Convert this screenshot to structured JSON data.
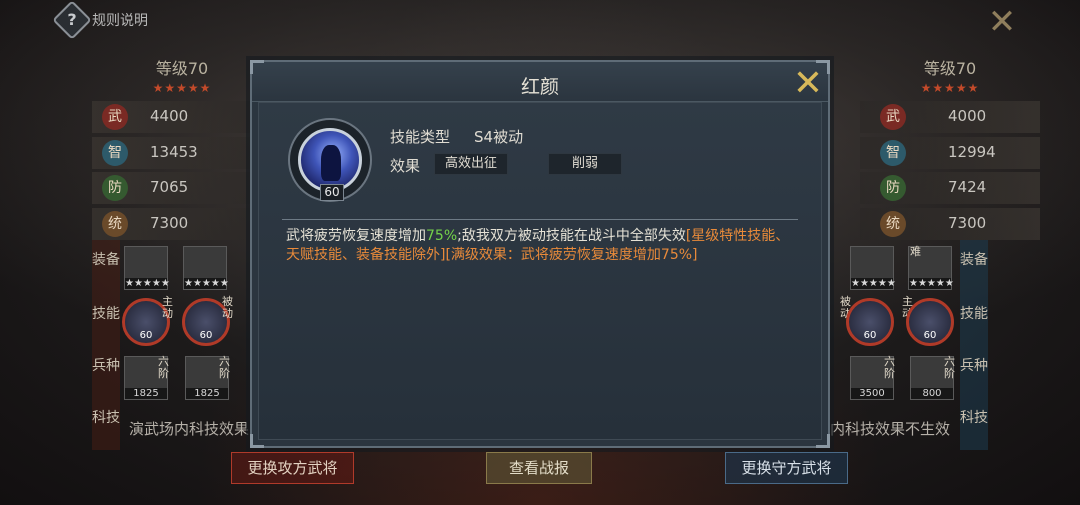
{
  "topbar": {
    "rules_label": "规则说明",
    "help_glyph": "?"
  },
  "left": {
    "level": "等级70",
    "stars": "★★★★★",
    "stats": [
      {
        "icon": "武",
        "value": "4400"
      },
      {
        "icon": "智",
        "value": "13453"
      },
      {
        "icon": "防",
        "value": "7065"
      },
      {
        "icon": "统",
        "value": "7300"
      }
    ],
    "labels": [
      "装备",
      "技能",
      "兵种",
      "科技"
    ],
    "equip_stars": "★★★★★",
    "skill_tag": "主动",
    "skill_tag2": "被动",
    "skill_levels": [
      "60",
      "60"
    ],
    "troop_counts": [
      "1825",
      "1825"
    ],
    "troop_tag": "六阶",
    "tech_text": "演武场内科技效果"
  },
  "right": {
    "level": "等级70",
    "stars": "★★★★★",
    "stats": [
      {
        "icon": "武",
        "value": "4000"
      },
      {
        "icon": "智",
        "value": "12994"
      },
      {
        "icon": "防",
        "value": "7424"
      },
      {
        "icon": "统",
        "value": "7300"
      }
    ],
    "labels": [
      "装备",
      "技能",
      "兵种",
      "科技"
    ],
    "equip_tag": "难",
    "equip_stars": "★★★★★",
    "skill_tag": "被动",
    "skill_tag2": "主动",
    "skill_levels": [
      "60",
      "60"
    ],
    "troop_counts": [
      "3500",
      "800"
    ],
    "troop_tag": "六阶",
    "tech_text": "内科技效果不生效"
  },
  "buttons": {
    "attack": "更换攻方武将",
    "report": "查看战报",
    "defend": "更换守方武将"
  },
  "modal": {
    "title": "红颜",
    "skill_level": "60",
    "type_label": "技能类型",
    "type_value": "S4被动",
    "effect_label": "效果",
    "effect_tags": [
      "高效出征",
      "削弱"
    ],
    "desc_part1": "武将疲劳恢复速度增加",
    "desc_green": "75%",
    "desc_part2": ";敌我双方被动技能在战斗中全部失效",
    "desc_orange": "[星级特性技能、天赋技能、装备技能除外][满级效果：武将疲劳恢复速度增加75%]"
  },
  "colors": {
    "modal_bg": "#2b353f",
    "highlight_green": "#74d24a",
    "highlight_orange": "#e88a3a",
    "close_gold": "#d8b95a"
  }
}
